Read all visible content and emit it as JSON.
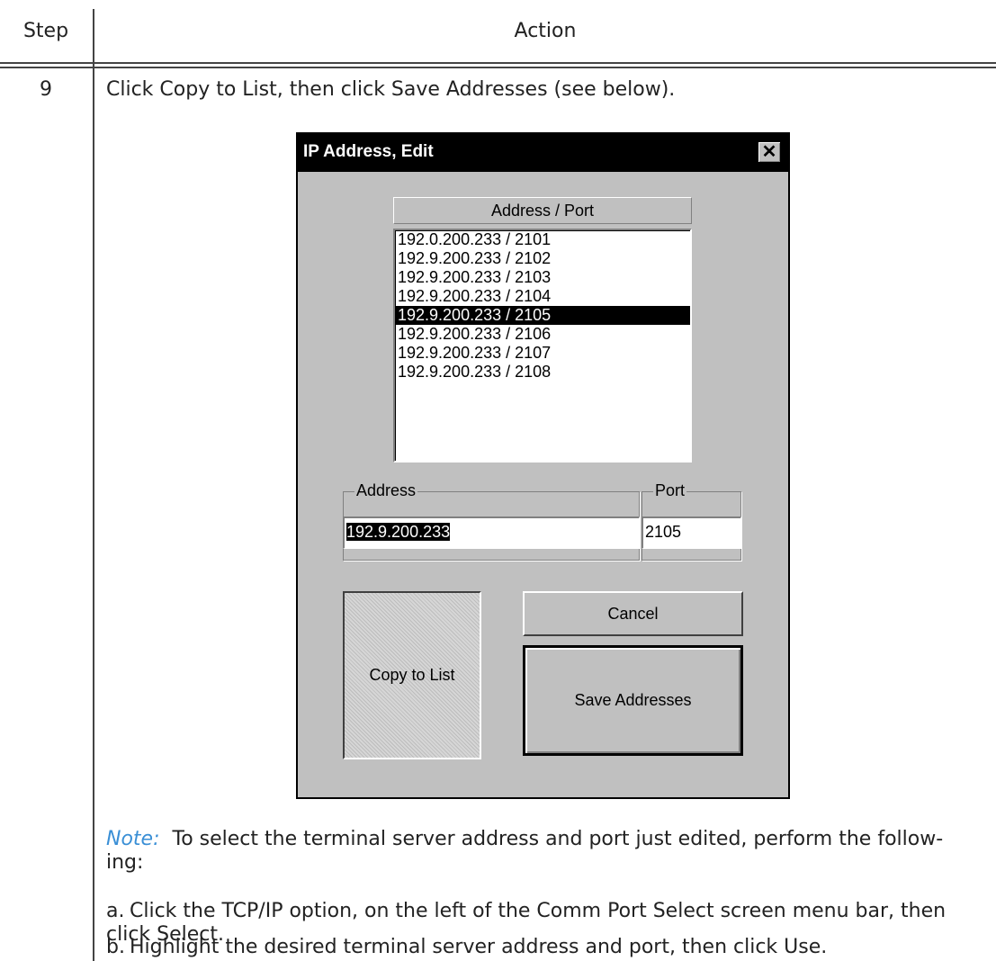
{
  "table": {
    "header_step": "Step",
    "header_action": "Action",
    "step_number": "9",
    "instruction": "Click Copy to List, then click Save Addresses (see below)."
  },
  "dialog": {
    "title": "IP Address, Edit",
    "close_glyph": "✕",
    "list_header": "Address / Port",
    "list_items": [
      "192.0.200.233 / 2101",
      "192.9.200.233 / 2102",
      "192.9.200.233 / 2103",
      "192.9.200.233 / 2104",
      "192.9.200.233 / 2105",
      "192.9.200.233 / 2106",
      "192.9.200.233 / 2107",
      "192.9.200.233 / 2108"
    ],
    "selected_index": 4,
    "address_label": "Address",
    "port_label": "Port",
    "address_value": "192.9.200.233",
    "port_value": "2105",
    "copy_button": "Copy to List",
    "cancel_button": "Cancel",
    "save_button": "Save Addresses"
  },
  "note": {
    "label": "Note:",
    "text": "To select the terminal server address and port just edited, perform the follow-ing:"
  },
  "substeps": [
    {
      "letter": "a.",
      "text": "Click the TCP/IP option, on the left of the Comm Port Select screen menu bar, then click Select."
    },
    {
      "letter": "b.",
      "text": "Highlight the desired terminal server address and port, then click Use."
    }
  ]
}
